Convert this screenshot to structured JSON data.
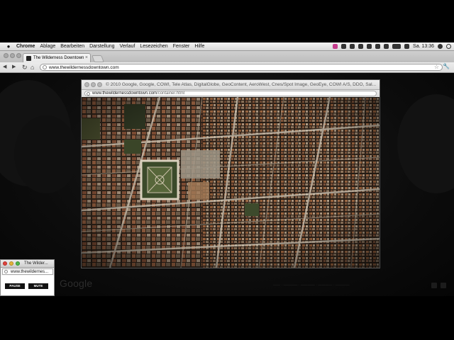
{
  "menubar": {
    "apple_icon": "apple-icon",
    "app": "Chrome",
    "items": [
      "Ablage",
      "Bearbeiten",
      "Darstellung",
      "Verlauf",
      "Lesezeichen",
      "Fenster",
      "Hilfe"
    ],
    "clock": "Sa. 13:36"
  },
  "browser": {
    "tab_title": "The Wilderness Downtown",
    "tab_close": "×",
    "back": "◀",
    "forward": "▶",
    "reload": "↻",
    "home": "⌂",
    "url": "www.thewildernessdowntown.com",
    "star": "☆",
    "wrench": "🔧"
  },
  "popup": {
    "title": "© 2010 Google, Google, COWI, Tele Atlas, DigitalGlobe, GeoContent, AeroWest, Cnes/Spot Image, GeoEye, COWI A/S, DDO, Sal...",
    "url_host": "www.thewildernessdowntown.com",
    "url_path": "/container.html"
  },
  "small_window": {
    "title": "The Wilder...",
    "url": "www.thewildernes...",
    "buttons": [
      "PAUSE",
      "MUTE"
    ]
  },
  "page": {
    "logo": "Google"
  },
  "colors": {
    "accent_red": "#e0443e",
    "accent_yellow": "#e2b33c",
    "accent_green": "#4fb84a"
  }
}
